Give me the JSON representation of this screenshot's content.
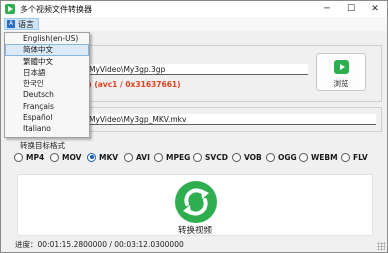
{
  "window": {
    "title": "多个视频文件转换器",
    "min_glyph": "─",
    "max_glyph": "☐",
    "close_glyph": "✕"
  },
  "menu": {
    "language_label": "语言",
    "language_icon_glyph": "A",
    "language_options": [
      "English(en-US)",
      "简体中文",
      "繁體中文",
      "日本語",
      "한국인",
      "Deutsch",
      "Français",
      "Español",
      "Italiano"
    ],
    "selected_language": "简体中文"
  },
  "source": {
    "path": "MyVideo\\My3gp.3gp",
    "codec_info": "igh) (avc1 / 0x31637661)",
    "browse_label": "浏览"
  },
  "output": {
    "path": "MyVideo\\My3gp_MKV.mkv"
  },
  "format_section": {
    "label": "转换目标格式",
    "formats": [
      "MP4",
      "MOV",
      "MKV",
      "AVI",
      "MPEG",
      "SVCD",
      "VOB",
      "OGG",
      "WEBM",
      "FLV"
    ],
    "selected": "MKV"
  },
  "convert": {
    "label": "转换视频",
    "icon": "refresh-icon"
  },
  "progress": {
    "text": "进度：00:01:15.2800000 / 00:03:12.0300000"
  },
  "colors": {
    "accent_green": "#2fae4f",
    "codec_red": "#e0421f",
    "selection_blue": "#1a5fb4"
  }
}
